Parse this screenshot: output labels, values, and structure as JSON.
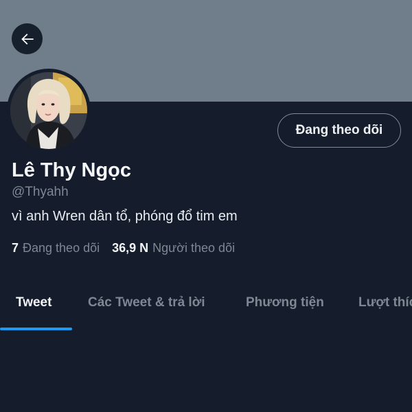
{
  "header": {
    "back_icon": "arrow-left-icon",
    "banner_color": "#707d8b"
  },
  "profile": {
    "avatar_icon": "profile-avatar",
    "follow_button_label": "Đang theo dõi",
    "name": "Lê Thy Ngọc",
    "handle": "@Thyahh",
    "bio": "vì anh Wren dân tổ, phóng đổ tim em",
    "following_count": "7",
    "following_label": "Đang theo dõi",
    "followers_count": "36,9 N",
    "followers_label": "Người theo dõi"
  },
  "tabs": [
    {
      "label": "Tweet",
      "active": true
    },
    {
      "label": "Các Tweet & trả lời",
      "active": false
    },
    {
      "label": "Phương tiện",
      "active": false
    },
    {
      "label": "Lượt thích",
      "active": false
    }
  ],
  "colors": {
    "background": "#151d2c",
    "accent": "#1d9bf0",
    "secondary_text": "#7d8894"
  }
}
